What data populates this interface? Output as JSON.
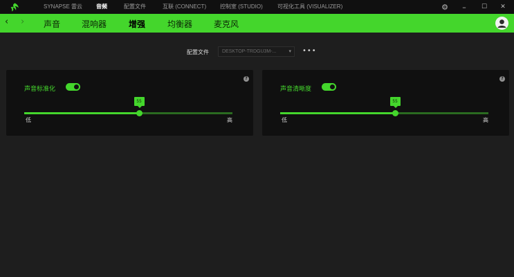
{
  "titlebar": {
    "nav": [
      {
        "label": "SYNAPSE 雷云",
        "active": false
      },
      {
        "label": "音频",
        "active": true
      },
      {
        "label": "配置文件",
        "active": false
      },
      {
        "label": "互联 (CONNECT)",
        "active": false
      },
      {
        "label": "控制室 (STUDIO)",
        "active": false
      },
      {
        "label": "可视化工具 (VISUALIZER)",
        "active": false
      }
    ],
    "controls": {
      "settings": "⚙",
      "minimize": "–",
      "maximize": "☐",
      "close": "✕"
    }
  },
  "subnav": {
    "back": "‹",
    "forward": "›",
    "tabs": [
      {
        "label": "声音",
        "active": false
      },
      {
        "label": "混响器",
        "active": false
      },
      {
        "label": "增强",
        "active": true
      },
      {
        "label": "均衡器",
        "active": false
      },
      {
        "label": "麦克风",
        "active": false
      }
    ]
  },
  "profile": {
    "label": "配置文件",
    "selected": "DESKTOP-TRDGU3M-...",
    "caret": "▾",
    "more": "•••"
  },
  "cards": [
    {
      "title": "声音标准化",
      "enabled": true,
      "value": 55,
      "value_text": "55",
      "min": 0,
      "max": 100,
      "low_label": "低",
      "high_label": "高",
      "help": "?"
    },
    {
      "title": "声音清晰度",
      "enabled": true,
      "value": 55,
      "value_text": "55",
      "min": 0,
      "max": 100,
      "low_label": "低",
      "high_label": "高",
      "help": "?"
    }
  ],
  "colors": {
    "accent": "#44d62c",
    "background": "#1e1e1e",
    "card": "#101010",
    "titlebar": "#101010"
  }
}
